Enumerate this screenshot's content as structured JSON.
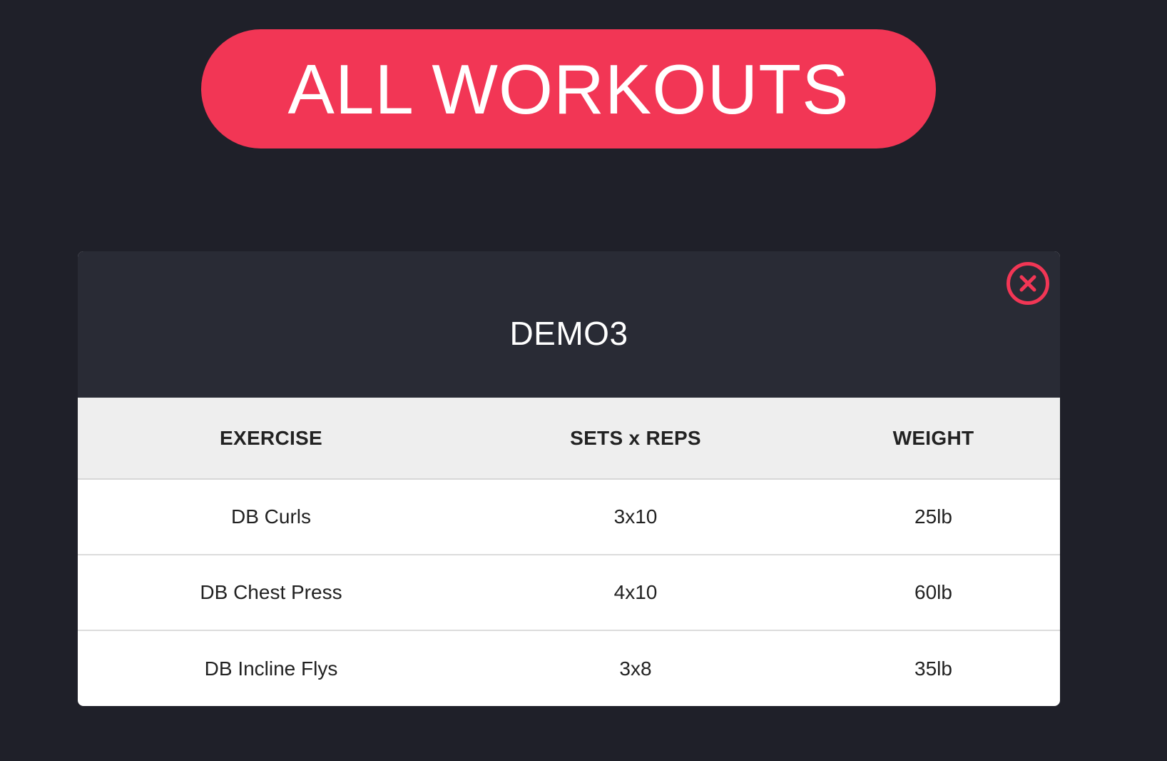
{
  "header": {
    "title": "ALL WORKOUTS"
  },
  "workout": {
    "name": "DEMO3",
    "close_icon": "close-circle-icon",
    "columns": [
      "EXERCISE",
      "SETS x REPS",
      "WEIGHT"
    ],
    "rows": [
      [
        "DB Curls",
        "3x10",
        "25lb"
      ],
      [
        "DB Chest Press",
        "4x10",
        "60lb"
      ],
      [
        "DB Incline Flys",
        "3x8",
        "35lb"
      ]
    ]
  },
  "colors": {
    "background": "#1f2029",
    "accent": "#f23655",
    "card_header": "#292b35",
    "table_header": "#eeeeee"
  }
}
